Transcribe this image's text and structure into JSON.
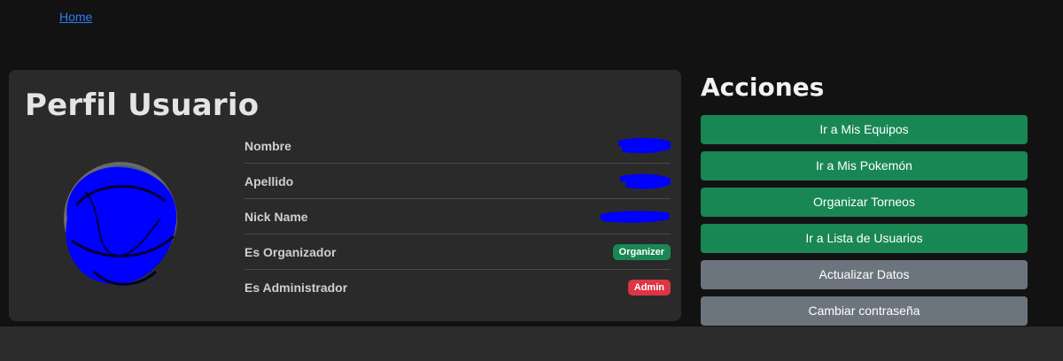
{
  "nav": {
    "home_label": "Home"
  },
  "profile": {
    "title": "Perfil Usuario",
    "fields": [
      {
        "label": "Nombre"
      },
      {
        "label": "Apellido"
      },
      {
        "label": "Nick Name"
      },
      {
        "label": "Es Organizador",
        "badge": "Organizer"
      },
      {
        "label": "Es Administrador",
        "badge": "Admin"
      }
    ]
  },
  "actions": {
    "title": "Acciones",
    "buttons": [
      {
        "label": "Ir a Mis Equipos"
      },
      {
        "label": "Ir a Mis Pokemón"
      },
      {
        "label": "Organizar Torneos"
      },
      {
        "label": "Ir a Lista de Usuarios"
      },
      {
        "label": "Actualizar Datos"
      },
      {
        "label": "Cambiar contraseña"
      }
    ]
  },
  "colors": {
    "success": "#198754",
    "secondary": "#6c757d",
    "danger": "#dc3545",
    "link": "#2f7bf5",
    "redaction": "#0000ff"
  }
}
